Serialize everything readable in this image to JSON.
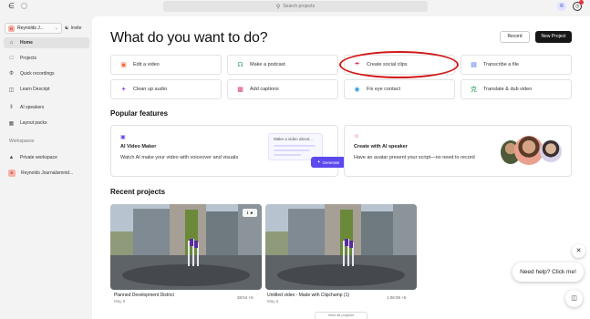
{
  "topbar": {
    "search_placeholder": "Search projects",
    "avatar_initial": "R"
  },
  "sidebar": {
    "workspace_initial": "R",
    "workspace_name": "Reynolds J...",
    "invite_label": "Invite",
    "items": [
      {
        "label": "Home",
        "icon": "home-icon"
      },
      {
        "label": "Projects",
        "icon": "folder-icon"
      },
      {
        "label": "Quick recordings",
        "icon": "lightning-icon"
      },
      {
        "label": "Learn Descript",
        "icon": "book-icon"
      },
      {
        "label": "AI speakers",
        "icon": "voice-icon"
      },
      {
        "label": "Layout packs",
        "icon": "grid-icon"
      }
    ],
    "workspaces_label": "Workspaces",
    "workspace_items": [
      {
        "label": "Private workspace",
        "icon": "lock-icon"
      },
      {
        "label": "Reynolds Journalismnid...",
        "initial": "R"
      }
    ]
  },
  "main": {
    "heading": "What do you want to do?",
    "record_label": "Record",
    "new_project_label": "New Project",
    "actions": [
      {
        "label": "Edit a video",
        "icon": "video-icon",
        "color": "#f26b3a"
      },
      {
        "label": "Make a podcast",
        "icon": "headphones-icon",
        "color": "#2fa35a"
      },
      {
        "label": "Create social clips",
        "icon": "megaphone-icon",
        "color": "#e0416d"
      },
      {
        "label": "Transcribe a file",
        "icon": "document-icon",
        "color": "#3a63e0"
      },
      {
        "label": "Clean up audio",
        "icon": "sparkle-icon",
        "color": "#8a4fe0"
      },
      {
        "label": "Add captions",
        "icon": "captions-icon",
        "color": "#e0416d"
      },
      {
        "label": "Fix eye contact",
        "icon": "eye-icon",
        "color": "#2f9be0"
      },
      {
        "label": "Translate & dub video",
        "icon": "translate-icon",
        "color": "#2fa35a"
      }
    ],
    "popular_label": "Popular features",
    "features": [
      {
        "title": "AI Video Maker",
        "description": "Watch AI make your video with voiceover and visuals",
        "mock_text": "Make a video about...",
        "generate_label": "Generate"
      },
      {
        "title": "Create with AI speaker",
        "description": "Have an avatar present your script—no need to record"
      }
    ],
    "recent_label": "Recent projects",
    "projects": [
      {
        "title": "Planned Development District",
        "date": "May 9",
        "duration": "38:54 +5"
      },
      {
        "title": "Untitled video - Made with Clipchamp (1)",
        "date": "May 6",
        "duration": "1:06:08 +5"
      }
    ],
    "load_more_label": "View all projects"
  },
  "help": {
    "bubble_text": "Need help? Click me!"
  }
}
